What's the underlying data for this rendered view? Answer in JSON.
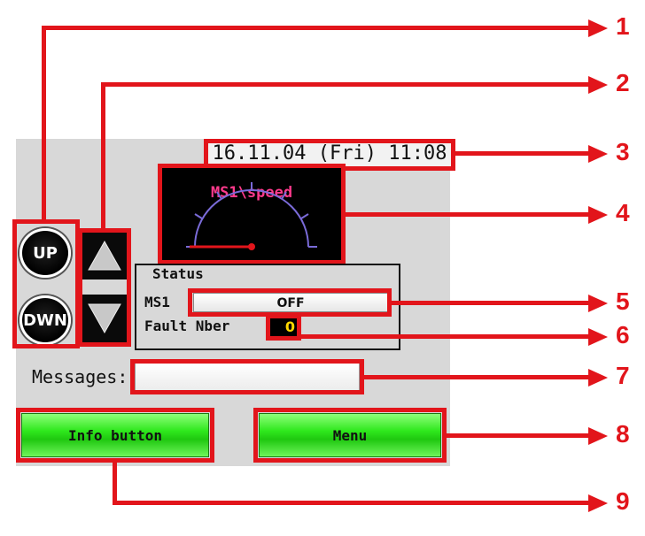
{
  "datetime": "16.11.04 (Fri) 11:08",
  "gauge": {
    "title": "MS1\\speed"
  },
  "buttons": {
    "up": "UP",
    "down": "DWN"
  },
  "status": {
    "title": "Status",
    "ms1_label": "MS1",
    "ms1_value": "OFF",
    "fault_label": "Fault Nber",
    "fault_value": "0"
  },
  "messages": {
    "label": "Messages:",
    "value": ""
  },
  "footer": {
    "info_button": "Info button",
    "menu_button": "Menu"
  },
  "callouts": [
    "1",
    "2",
    "3",
    "4",
    "5",
    "6",
    "7",
    "8",
    "9"
  ],
  "colors": {
    "callout": "#e2151b",
    "button_green": "#2fe81d",
    "panel": "#d8d8d8"
  }
}
